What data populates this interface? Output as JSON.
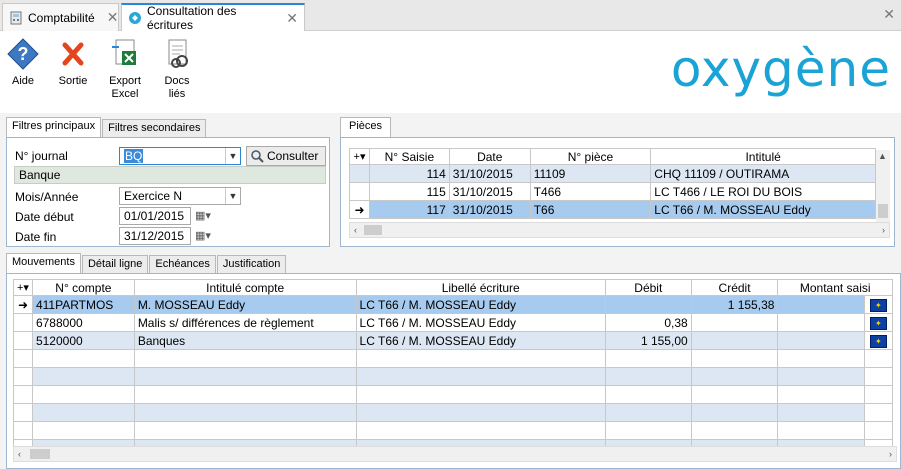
{
  "tabs": [
    {
      "label": "Comptabilité"
    },
    {
      "label": "Consultation des écritures"
    }
  ],
  "toolbar": {
    "aide": "Aide",
    "sortie": "Sortie",
    "export_l1": "Export",
    "export_l2": "Excel",
    "docs_l1": "Docs",
    "docs_l2": "liés"
  },
  "logo": "oxygène",
  "filters": {
    "tab_main": "Filtres principaux",
    "tab_secondary": "Filtres secondaires",
    "journal_label": "N° journal",
    "journal_value": "BQ",
    "journal_name": "Banque",
    "consult_button": "Consulter",
    "period_label": "Mois/Année",
    "period_value": "Exercice N",
    "start_label": "Date début",
    "start_value": "01/01/2015",
    "end_label": "Date fin",
    "end_value": "31/12/2015"
  },
  "pieces": {
    "tab": "Pièces",
    "columns": [
      "N° Saisie",
      "Date",
      "N° pièce",
      "Intitulé"
    ],
    "rows": [
      {
        "saisie": "114",
        "date": "31/10/2015",
        "piece": "11109",
        "intitule": "CHQ 11109 / OUTIRAMA"
      },
      {
        "saisie": "115",
        "date": "31/10/2015",
        "piece": "T466",
        "intitule": "LC T466 / LE ROI DU BOIS"
      },
      {
        "saisie": "117",
        "date": "31/10/2015",
        "piece": "T66",
        "intitule": "LC T66 / M. MOSSEAU Eddy"
      }
    ]
  },
  "bottom_tabs": [
    "Mouvements",
    "Détail ligne",
    "Echéances",
    "Justification"
  ],
  "mouvements": {
    "columns": [
      "N° compte",
      "Intitulé compte",
      "Libellé écriture",
      "Débit",
      "Crédit",
      "Montant saisi"
    ],
    "rows": [
      {
        "compte": "411PARTMOS",
        "intitule": "M. MOSSEAU Eddy",
        "libelle": "LC T66 / M. MOSSEAU Eddy",
        "debit": "",
        "credit": "1 155,38"
      },
      {
        "compte": "6788000",
        "intitule": "Malis s/ différences de règlement",
        "libelle": "LC T66 / M. MOSSEAU Eddy",
        "debit": "0,38",
        "credit": ""
      },
      {
        "compte": "5120000",
        "intitule": "Banques",
        "libelle": "LC T66 / M. MOSSEAU Eddy",
        "debit": "1 155,00",
        "credit": ""
      }
    ]
  },
  "icons": {
    "help": "help-icon",
    "exit": "close-x-icon",
    "excel": "excel-export-icon",
    "docs": "linked-docs-icon"
  },
  "colors": {
    "accent": "#2b86d4",
    "selected_row": "#a6cbef",
    "alt_row": "#dde7f4",
    "logo": "#1aa3d4"
  }
}
